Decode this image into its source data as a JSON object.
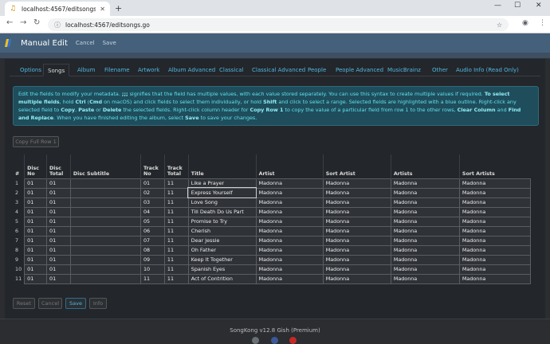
{
  "browser": {
    "tab_title": "localhost:4567/editsongs.go",
    "url": "localhost:4567/editsongs.go"
  },
  "header": {
    "title": "Manual Edit",
    "cancel": "Cancel",
    "save": "Save"
  },
  "tabs": [
    "Options",
    "Songs",
    "Album",
    "Filename",
    "Artwork",
    "Album Advanced",
    "Classical",
    "Classical Advanced",
    "People",
    "People Advanced",
    "MusicBrainz",
    "Other",
    "Audio Info (Read Only)"
  ],
  "info": {
    "t1": "Edit the fields to modify your metadata. ",
    "t2": ";;;",
    "t3": " signifies that the field has multiple values, with each value stored separately. You can use this syntax to create multiple values if required. ",
    "t4": "To select multiple fields",
    "t5": ", hold ",
    "t6": "Ctrl",
    "t7": " (",
    "t8": "Cmd",
    "t9": " on macOS) and click fields to select them individually, or hold ",
    "t10": "Shift",
    "t11": " and click to select a range. Selected fields are highlighted with a blue outline. Right-click any selected field to ",
    "t12": "Copy",
    "t13": ", ",
    "t14": "Paste",
    "t15": " or ",
    "t16": "Delete",
    "t17": " the selected fields. Right-click column header for ",
    "t18": "Copy Row 1",
    "t19": " to copy the value of a particular field from row 1 to the other rows, ",
    "t20": "Clear Column",
    "t21": " and ",
    "t22": "Find and Replace",
    "t23": ". When you have finished editing the album, select ",
    "t24": "Save",
    "t25": " to save your changes."
  },
  "copy_row_button": "Copy Full Row 1",
  "columns": {
    "num": "#",
    "disc_no": "Disc No",
    "disc_total": "Disc Total",
    "disc_subtitle": "Disc Subtitle",
    "track_no": "Track No",
    "track_total": "Track Total",
    "title": "Title",
    "artist": "Artist",
    "sort_artist": "Sort Artist",
    "artists": "Artists",
    "sort_artists": "Sort Artists"
  },
  "rows": [
    {
      "n": "1",
      "disc": "01",
      "dt": "01",
      "ds": "",
      "tn": "01",
      "tt": "11",
      "title": "Like a Prayer",
      "artist": "Madonna",
      "sa": "Madonna",
      "as": "Madonna",
      "sas": "Madonna"
    },
    {
      "n": "2",
      "disc": "01",
      "dt": "01",
      "ds": "",
      "tn": "02",
      "tt": "11",
      "title": "Express Yourself",
      "artist": "Madonna",
      "sa": "Madonna",
      "as": "Madonna",
      "sas": "Madonna"
    },
    {
      "n": "3",
      "disc": "01",
      "dt": "01",
      "ds": "",
      "tn": "03",
      "tt": "11",
      "title": "Love Song",
      "artist": "Madonna",
      "sa": "Madonna",
      "as": "Madonna",
      "sas": "Madonna"
    },
    {
      "n": "4",
      "disc": "01",
      "dt": "01",
      "ds": "",
      "tn": "04",
      "tt": "11",
      "title": "Till Death Do Us Part",
      "artist": "Madonna",
      "sa": "Madonna",
      "as": "Madonna",
      "sas": "Madonna"
    },
    {
      "n": "5",
      "disc": "01",
      "dt": "01",
      "ds": "",
      "tn": "05",
      "tt": "11",
      "title": "Promise to Try",
      "artist": "Madonna",
      "sa": "Madonna",
      "as": "Madonna",
      "sas": "Madonna"
    },
    {
      "n": "6",
      "disc": "01",
      "dt": "01",
      "ds": "",
      "tn": "06",
      "tt": "11",
      "title": "Cherish",
      "artist": "Madonna",
      "sa": "Madonna",
      "as": "Madonna",
      "sas": "Madonna"
    },
    {
      "n": "7",
      "disc": "01",
      "dt": "01",
      "ds": "",
      "tn": "07",
      "tt": "11",
      "title": "Dear Jessie",
      "artist": "Madonna",
      "sa": "Madonna",
      "as": "Madonna",
      "sas": "Madonna"
    },
    {
      "n": "8",
      "disc": "01",
      "dt": "01",
      "ds": "",
      "tn": "08",
      "tt": "11",
      "title": "Oh Father",
      "artist": "Madonna",
      "sa": "Madonna",
      "as": "Madonna",
      "sas": "Madonna"
    },
    {
      "n": "9",
      "disc": "01",
      "dt": "01",
      "ds": "",
      "tn": "09",
      "tt": "11",
      "title": "Keep It Together",
      "artist": "Madonna",
      "sa": "Madonna",
      "as": "Madonna",
      "sas": "Madonna"
    },
    {
      "n": "10",
      "disc": "01",
      "dt": "01",
      "ds": "",
      "tn": "10",
      "tt": "11",
      "title": "Spanish Eyes",
      "artist": "Madonna",
      "sa": "Madonna",
      "as": "Madonna",
      "sas": "Madonna"
    },
    {
      "n": "11",
      "disc": "01",
      "dt": "01",
      "ds": "",
      "tn": "11",
      "tt": "11",
      "title": "Act of Contrition",
      "artist": "Madonna",
      "sa": "Madonna",
      "as": "Madonna",
      "sas": "Madonna"
    }
  ],
  "buttons": {
    "reset": "Reset",
    "cancel": "Cancel",
    "save": "Save",
    "info": "Info"
  },
  "footer": "SongKong v12.8 Gish (Premium)",
  "colors": {
    "accent": "#4fb8e3",
    "header": "#45607a",
    "info_text": "#5fe3ee"
  }
}
